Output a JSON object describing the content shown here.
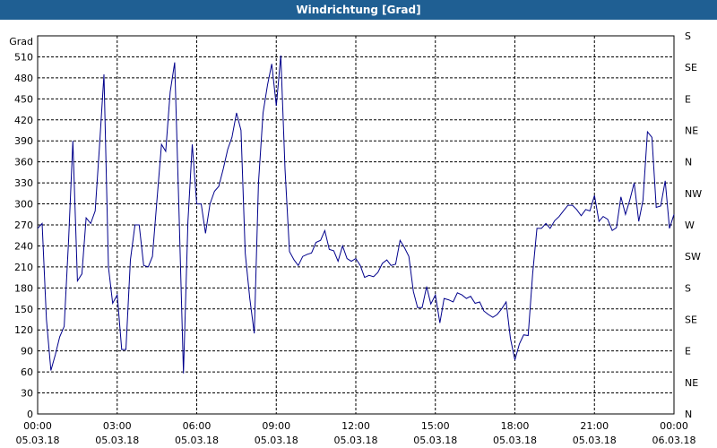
{
  "window": {
    "title": "Windrichtung [Grad]"
  },
  "chart_data": {
    "type": "line",
    "title": "Windrichtung [Grad]",
    "ylabel": "Grad",
    "ylim": [
      0,
      540
    ],
    "yticks": [
      0,
      30,
      60,
      90,
      120,
      150,
      180,
      210,
      240,
      270,
      300,
      330,
      360,
      390,
      420,
      450,
      480,
      510
    ],
    "right_ticks": [
      {
        "value": 0,
        "label": "N"
      },
      {
        "value": 45,
        "label": "NE"
      },
      {
        "value": 90,
        "label": "E"
      },
      {
        "value": 135,
        "label": "SE"
      },
      {
        "value": 180,
        "label": "S"
      },
      {
        "value": 225,
        "label": "SW"
      },
      {
        "value": 270,
        "label": "W"
      },
      {
        "value": 315,
        "label": "NW"
      },
      {
        "value": 360,
        "label": "N"
      },
      {
        "value": 405,
        "label": "NE"
      },
      {
        "value": 450,
        "label": "E"
      },
      {
        "value": 495,
        "label": "SE"
      },
      {
        "value": 540,
        "label": "S"
      }
    ],
    "xlim": [
      0,
      24
    ],
    "xticks": [
      {
        "x": 0,
        "time": "00:00",
        "date": "05.03.18"
      },
      {
        "x": 3,
        "time": "03:00",
        "date": "05.03.18"
      },
      {
        "x": 6,
        "time": "06:00",
        "date": "05.03.18"
      },
      {
        "x": 9,
        "time": "09:00",
        "date": "05.03.18"
      },
      {
        "x": 12,
        "time": "12:00",
        "date": "05.03.18"
      },
      {
        "x": 15,
        "time": "15:00",
        "date": "05.03.18"
      },
      {
        "x": 18,
        "time": "18:00",
        "date": "05.03.18"
      },
      {
        "x": 21,
        "time": "21:00",
        "date": "05.03.18"
      },
      {
        "x": 24,
        "time": "00:00",
        "date": "06.03.18"
      }
    ],
    "grid": true,
    "series": [
      {
        "color": "#00008b",
        "points": [
          [
            0.0,
            265
          ],
          [
            0.17,
            272
          ],
          [
            0.33,
            135
          ],
          [
            0.5,
            62
          ],
          [
            0.67,
            85
          ],
          [
            0.83,
            110
          ],
          [
            1.0,
            125
          ],
          [
            1.17,
            250
          ],
          [
            1.33,
            390
          ],
          [
            1.5,
            190
          ],
          [
            1.67,
            200
          ],
          [
            1.83,
            280
          ],
          [
            2.0,
            272
          ],
          [
            2.17,
            290
          ],
          [
            2.33,
            380
          ],
          [
            2.5,
            485
          ],
          [
            2.67,
            210
          ],
          [
            2.83,
            158
          ],
          [
            3.0,
            170
          ],
          [
            3.17,
            92
          ],
          [
            3.33,
            92
          ],
          [
            3.5,
            220
          ],
          [
            3.67,
            270
          ],
          [
            3.83,
            270
          ],
          [
            4.0,
            212
          ],
          [
            4.17,
            210
          ],
          [
            4.33,
            225
          ],
          [
            4.5,
            305
          ],
          [
            4.67,
            385
          ],
          [
            4.83,
            375
          ],
          [
            5.0,
            460
          ],
          [
            5.17,
            502
          ],
          [
            5.33,
            290
          ],
          [
            5.5,
            58
          ],
          [
            5.67,
            275
          ],
          [
            5.83,
            385
          ],
          [
            6.0,
            300
          ],
          [
            6.17,
            300
          ],
          [
            6.33,
            258
          ],
          [
            6.5,
            300
          ],
          [
            6.67,
            318
          ],
          [
            6.83,
            325
          ],
          [
            7.0,
            350
          ],
          [
            7.17,
            378
          ],
          [
            7.33,
            395
          ],
          [
            7.5,
            430
          ],
          [
            7.67,
            405
          ],
          [
            7.83,
            230
          ],
          [
            8.0,
            165
          ],
          [
            8.17,
            115
          ],
          [
            8.33,
            330
          ],
          [
            8.5,
            430
          ],
          [
            8.67,
            470
          ],
          [
            8.83,
            500
          ],
          [
            9.0,
            440
          ],
          [
            9.17,
            512
          ],
          [
            9.33,
            350
          ],
          [
            9.5,
            232
          ],
          [
            9.67,
            220
          ],
          [
            9.83,
            212
          ],
          [
            10.0,
            225
          ],
          [
            10.17,
            228
          ],
          [
            10.33,
            230
          ],
          [
            10.5,
            245
          ],
          [
            10.67,
            248
          ],
          [
            10.83,
            262
          ],
          [
            11.0,
            235
          ],
          [
            11.17,
            233
          ],
          [
            11.33,
            218
          ],
          [
            11.5,
            240
          ],
          [
            11.67,
            222
          ],
          [
            11.83,
            218
          ],
          [
            12.0,
            222
          ],
          [
            12.17,
            212
          ],
          [
            12.33,
            195
          ],
          [
            12.5,
            198
          ],
          [
            12.67,
            196
          ],
          [
            12.83,
            202
          ],
          [
            13.0,
            215
          ],
          [
            13.17,
            220
          ],
          [
            13.33,
            212
          ],
          [
            13.5,
            214
          ],
          [
            13.67,
            248
          ],
          [
            13.83,
            238
          ],
          [
            14.0,
            225
          ],
          [
            14.17,
            175
          ],
          [
            14.33,
            152
          ],
          [
            14.5,
            152
          ],
          [
            14.67,
            182
          ],
          [
            14.83,
            157
          ],
          [
            15.0,
            170
          ],
          [
            15.17,
            130
          ],
          [
            15.33,
            165
          ],
          [
            15.5,
            163
          ],
          [
            15.67,
            160
          ],
          [
            15.83,
            173
          ],
          [
            16.0,
            170
          ],
          [
            16.17,
            165
          ],
          [
            16.33,
            168
          ],
          [
            16.5,
            158
          ],
          [
            16.67,
            160
          ],
          [
            16.83,
            147
          ],
          [
            17.0,
            142
          ],
          [
            17.17,
            138
          ],
          [
            17.33,
            142
          ],
          [
            17.5,
            150
          ],
          [
            17.67,
            160
          ],
          [
            17.83,
            108
          ],
          [
            18.0,
            77
          ],
          [
            18.17,
            100
          ],
          [
            18.33,
            113
          ],
          [
            18.5,
            112
          ],
          [
            18.67,
            200
          ],
          [
            18.83,
            265
          ],
          [
            19.0,
            265
          ],
          [
            19.17,
            272
          ],
          [
            19.33,
            265
          ],
          [
            19.5,
            276
          ],
          [
            19.67,
            282
          ],
          [
            19.83,
            290
          ],
          [
            20.0,
            298
          ],
          [
            20.17,
            298
          ],
          [
            20.33,
            292
          ],
          [
            20.5,
            283
          ],
          [
            20.67,
            292
          ],
          [
            20.83,
            290
          ],
          [
            21.0,
            312
          ],
          [
            21.17,
            275
          ],
          [
            21.33,
            282
          ],
          [
            21.5,
            278
          ],
          [
            21.67,
            262
          ],
          [
            21.83,
            266
          ],
          [
            22.0,
            310
          ],
          [
            22.17,
            285
          ],
          [
            22.33,
            305
          ],
          [
            22.5,
            330
          ],
          [
            22.67,
            275
          ],
          [
            22.83,
            305
          ],
          [
            23.0,
            403
          ],
          [
            23.17,
            395
          ],
          [
            23.33,
            295
          ],
          [
            23.5,
            297
          ],
          [
            23.67,
            333
          ],
          [
            23.83,
            265
          ],
          [
            24.0,
            285
          ]
        ]
      }
    ]
  }
}
